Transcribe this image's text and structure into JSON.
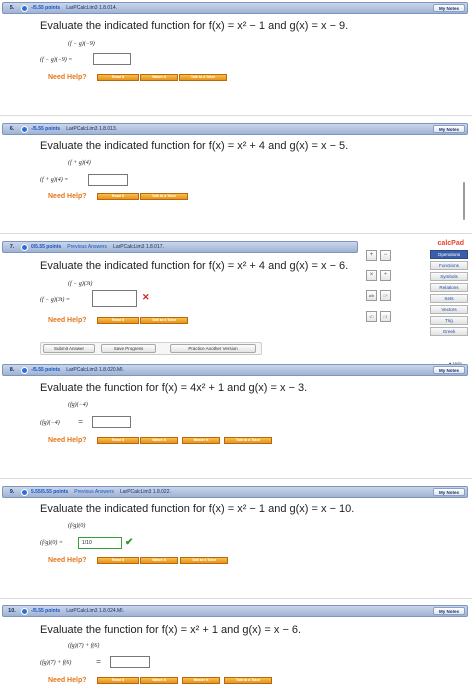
{
  "common": {
    "my_notes": "My Notes",
    "need_help": "Need Help?",
    "read_it": "Read It",
    "watch_it": "Watch It",
    "talk_tutor": "Talk to a Tutor",
    "master_it": "Master It",
    "and": "and",
    "equals": "="
  },
  "q5": {
    "num": "5.",
    "points": "-/5.55 points",
    "source": "LarPCalcLim3 1.8.014.",
    "prompt": "Evaluate the indicated function for",
    "f": "f(x) = x² − 1",
    "g": "g(x) = x − 9.",
    "sub": "(f − g)(−9)",
    "lhs": "(f − g)(−9) =",
    "answer": ""
  },
  "q6": {
    "num": "6.",
    "points": "-/5.55 points",
    "source": "LarPCalcLim3 1.8.013.",
    "prompt": "Evaluate the indicated function for",
    "f": "f(x) = x² + 4",
    "g": "g(x) = x − 5.",
    "sub": "(f + g)(4)",
    "lhs": "(f + g)(4) =",
    "answer": ""
  },
  "q7": {
    "num": "7.",
    "points": "0/5.55 points",
    "previous": "Previous Answers",
    "source": "LarPCalcLim3 1.8.017.",
    "prompt": "Evaluate the indicated function for",
    "f": "f(x) = x² + 4",
    "g": "g(x) = x − 6.",
    "sub": "(f − g)(3t)",
    "lhs": "(f − g)(3t) =",
    "answer": "",
    "submit": "Submit Answer",
    "save": "Save Progress",
    "practice": "Practice Another Version"
  },
  "calcpad": {
    "title": "calcPad",
    "keys": [
      "+",
      "−",
      "×",
      "÷",
      "a/b",
      "□ⁿ",
      "√□",
      "□!"
    ],
    "tabs": [
      "Operations",
      "Functions",
      "Symbols",
      "Relations",
      "Sets",
      "Vectors",
      "Trig",
      "Greek"
    ],
    "active_tab": "Operations",
    "help": "Help"
  },
  "q8": {
    "num": "8.",
    "points": "-/5.55 points",
    "source": "LarPCalcLim3 1.8.020.MI.",
    "prompt": "Evaluate the function for",
    "f": "f(x) = 4x² + 1 and g(x) = x − 3.",
    "sub": "(fg)(−4)",
    "lhs": "(fg)(−4)",
    "answer": ""
  },
  "q9": {
    "num": "9.",
    "points": "5.55/5.55 points",
    "previous": "Previous Answers",
    "source": "LarPCalcLim3 1.8.022.",
    "prompt": "Evaluate the indicated function for",
    "f": "f(x) = x² − 1",
    "g": "g(x) = x − 10.",
    "sub": "(f/g)(0)",
    "lhs": "(f/g)(0) =",
    "answer": "1/10"
  },
  "q10": {
    "num": "10.",
    "points": "-/5.55 points",
    "source": "LarPCalcLim3 1.8.024.MI.",
    "prompt": "Evaluate the function for",
    "f": "f(x) = x² + 1 and g(x) = x − 6.",
    "sub": "(fg)(7) + f(6)",
    "lhs": "(fg)(7) + f(6)",
    "answer": ""
  }
}
